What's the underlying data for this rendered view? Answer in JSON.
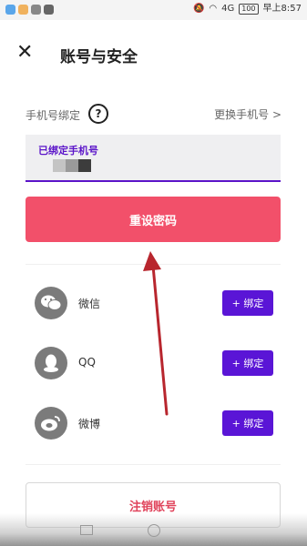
{
  "status_bar": {
    "time": "早上8:57",
    "battery": "100",
    "network": "4G"
  },
  "header": {
    "close_icon": "close-icon",
    "title": "账号与安全"
  },
  "phone_section": {
    "label": "手机号绑定",
    "help_icon": "question-circle-icon",
    "change_link": "更换手机号 >",
    "bound_label": "已绑定手机号"
  },
  "reset_button": "重设密码",
  "bindings": [
    {
      "name": "微信",
      "icon": "wechat-icon",
      "button": "+ 绑定"
    },
    {
      "name": "QQ",
      "icon": "qq-icon",
      "button": "+ 绑定"
    },
    {
      "name": "微博",
      "icon": "weibo-icon",
      "button": "+ 绑定"
    }
  ],
  "cancel_account": "注销账号",
  "colors": {
    "accent_purple": "#5a15d6",
    "reset_red": "#f2506a",
    "arrow_red": "#b8262e"
  }
}
